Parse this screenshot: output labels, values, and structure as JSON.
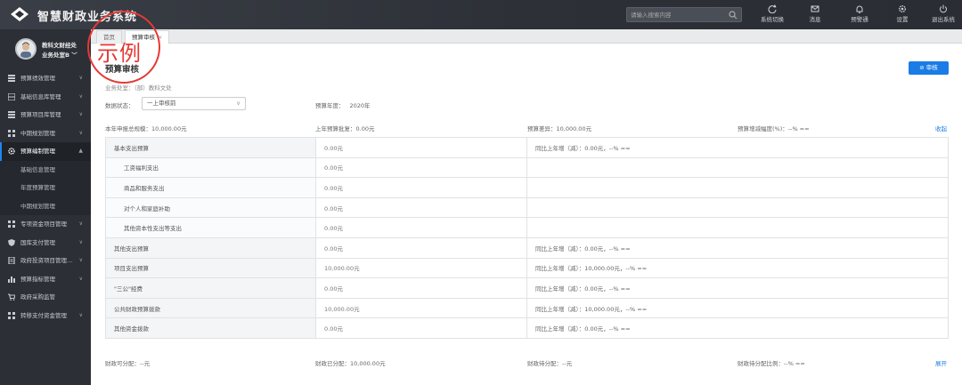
{
  "app": {
    "title": "智慧财政业务系统"
  },
  "header": {
    "search_placeholder": "请输入搜索内容",
    "tools": [
      {
        "label": "系统切换",
        "icon": "switch-icon"
      },
      {
        "label": "消息",
        "icon": "message-icon"
      },
      {
        "label": "预警通",
        "icon": "bell-icon"
      },
      {
        "label": "设置",
        "icon": "gear-icon"
      },
      {
        "label": "退出系统",
        "icon": "power-icon"
      }
    ]
  },
  "user": {
    "name": "教科文财经处",
    "dept": "业务处室B"
  },
  "sidebar": {
    "items": [
      {
        "label": "预算绩效管理"
      },
      {
        "label": "基础信息库管理"
      },
      {
        "label": "预算项目库管理"
      },
      {
        "label": "中期规划管理"
      },
      {
        "label": "预算编制管理"
      },
      {
        "label": "专项资金项目管理"
      },
      {
        "label": "国库支付管理"
      },
      {
        "label": "政府投资项目管理..."
      },
      {
        "label": "预算指标管理"
      },
      {
        "label": "政府采购监管"
      },
      {
        "label": "转移支付资金管理"
      }
    ],
    "subitems": [
      {
        "label": "基础信息管理"
      },
      {
        "label": "年度预算管理"
      },
      {
        "label": "中期规划管理"
      }
    ]
  },
  "tabs": {
    "home": "首页",
    "current": "预算审核",
    "close": "×"
  },
  "page": {
    "title": "预算审核",
    "approve_button": "审核",
    "unit": "业务处室：（部）教科文处",
    "data_status_label": "数据状态：",
    "data_status_value": "一上审核前",
    "budget_year_label": "预算年度：",
    "budget_year_value": "2020年"
  },
  "summary_top": {
    "a": "本年申报总规模：10,000.00元",
    "b": "上年预算批复：0.00元",
    "c": "预算差异：10,000.00元",
    "d": "预算增减幅度(%)：--% ==",
    "collapse": "收起"
  },
  "table": {
    "rows": [
      {
        "name": "基本支出预算",
        "amount": "0.00元",
        "compare": "同比上年增（减）：0.00元，--% ==",
        "indent": false
      },
      {
        "name": "工资福利支出",
        "amount": "0.00元",
        "compare": "",
        "indent": true
      },
      {
        "name": "商品和服务支出",
        "amount": "0.00元",
        "compare": "",
        "indent": true
      },
      {
        "name": "对个人和家庭补助",
        "amount": "0.00元",
        "compare": "",
        "indent": true
      },
      {
        "name": "其他资本性支出等支出",
        "amount": "0.00元",
        "compare": "",
        "indent": true
      },
      {
        "name": "其他支出预算",
        "amount": "0.00元",
        "compare": "同比上年增（减）：0.00元，--% ==",
        "indent": false
      },
      {
        "name": "项目支出预算",
        "amount": "10,000.00元",
        "compare": "同比上年增（减）：10,000.00元，--% ==",
        "indent": false
      },
      {
        "name": "\"三公\"经费",
        "amount": "0.00元",
        "compare": "同比上年增（减）：0.00元，--% ==",
        "indent": false
      },
      {
        "name": "公共财政预算拨款",
        "amount": "10,000.00元",
        "compare": "同比上年增（减）：10,000.00元，--% ==",
        "indent": false
      },
      {
        "name": "其他资金拨款",
        "amount": "0.00元",
        "compare": "同比上年增（减）：0.00元，--% ==",
        "indent": false
      }
    ]
  },
  "summary_bottom": {
    "a": "财政可分配：--元",
    "b": "财政已分配：10,000.00元",
    "c": "财政待分配：--元",
    "d": "财政待分配比例：--% ==",
    "expand": "展开"
  },
  "stamp": {
    "text": "示例",
    "color": "#e53935"
  },
  "colors": {
    "accent": "#1a7ce6",
    "topbar": "#2d3037",
    "sidebar": "#2c2f36"
  }
}
